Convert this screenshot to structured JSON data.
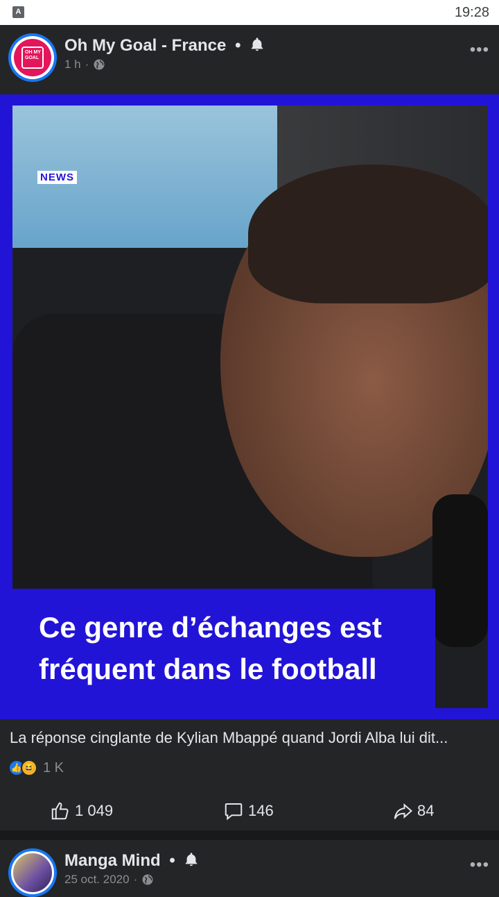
{
  "statusbar": {
    "app_icon_letter": "A",
    "time": "19:28"
  },
  "post": {
    "page_name": "Oh My Goal - France",
    "separator_dot": "•",
    "meta_time": "1 h",
    "meta_dot": "·",
    "more_label": "•••",
    "avatar_text": "OH MY GOAL",
    "video": {
      "overlay_badge": "NEWS",
      "caption": "Ce genre d’échanges est fréquent dans le football"
    },
    "title": "La réponse cinglante de Kylian Mbappé quand Jordi Alba lui dit...",
    "reactions": {
      "like_icon": "👍",
      "haha_icon": "😆",
      "count": "1 K"
    },
    "actions": {
      "like_count": "1 049",
      "comment_count": "146",
      "share_count": "84"
    }
  },
  "next_post": {
    "page_name": "Manga Mind",
    "separator_dot": "•",
    "meta_time": "25 oct. 2020",
    "meta_dot": "·",
    "more_label": "•••"
  },
  "colors": {
    "brand_blue": "#1877f2",
    "video_frame_blue": "#2214d6",
    "background": "#242526"
  }
}
